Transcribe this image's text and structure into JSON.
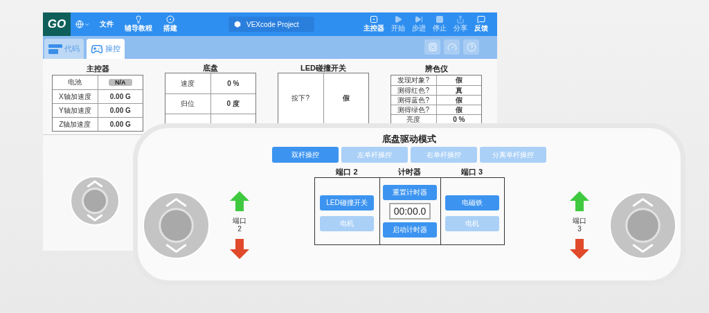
{
  "top_bar": {
    "logo": "GO",
    "project_title": "VEXcode Project",
    "left_items": [
      {
        "kind": "language"
      },
      {
        "kind": "menu",
        "label": "文件"
      },
      {
        "kind": "tutorial",
        "label": "辅导教程"
      },
      {
        "kind": "build",
        "label": "搭建"
      }
    ],
    "right_items": [
      {
        "kind": "brain",
        "label": "主控器",
        "disabled": false
      },
      {
        "kind": "start",
        "label": "开始",
        "disabled": true
      },
      {
        "kind": "step",
        "label": "步进",
        "disabled": true
      },
      {
        "kind": "stop",
        "label": "停止",
        "disabled": true
      },
      {
        "kind": "share",
        "label": "分享",
        "disabled": true
      },
      {
        "kind": "feedback",
        "label": "反馈",
        "disabled": false
      }
    ]
  },
  "tabs": [
    {
      "kind": "code",
      "label": "代码",
      "selected": false
    },
    {
      "kind": "drive",
      "label": "操控",
      "selected": true
    }
  ],
  "dashboard": [
    {
      "title": "主控器",
      "rows": [
        {
          "name": "电池",
          "value": "N/A",
          "kind": "battery"
        },
        {
          "name": "X轴加速度",
          "value": "0.00 G",
          "kind": "text"
        },
        {
          "name": "Y轴加速度",
          "value": "0.00 G",
          "kind": "text"
        },
        {
          "name": "Z轴加速度",
          "value": "0.00 G",
          "kind": "text"
        }
      ]
    },
    {
      "title": "底盘",
      "rows": [
        {
          "name": "速度",
          "value": "0 %",
          "kind": "text"
        },
        {
          "name": "归位",
          "value": "0 度",
          "kind": "text"
        }
      ]
    },
    {
      "title": "LED碰撞开关",
      "rows": [
        {
          "name": "按下?",
          "value": "假",
          "kind": "text"
        }
      ]
    },
    {
      "title": "辨色仪",
      "rows": [
        {
          "name": "发现对象?",
          "value": "假",
          "kind": "text"
        },
        {
          "name": "测得红色?",
          "value": "真",
          "kind": "text"
        },
        {
          "name": "测得蓝色?",
          "value": "假",
          "kind": "text"
        },
        {
          "name": "测得绿色?",
          "value": "假",
          "kind": "text"
        },
        {
          "name": "亮度",
          "value": "0 %",
          "kind": "text"
        }
      ]
    }
  ],
  "drive_panel": {
    "title": "底盘驱动模式",
    "modes": [
      {
        "label": "双杆操控",
        "selected": true
      },
      {
        "label": "左单杆操控",
        "selected": false
      },
      {
        "label": "右单杆操控",
        "selected": false
      },
      {
        "label": "分离单杆操控",
        "selected": false
      }
    ],
    "columns": [
      {
        "kind": "device",
        "title": "端口 2",
        "buttons": [
          {
            "label": "LED碰撞开关",
            "disabled": false
          },
          {
            "label": "电机",
            "disabled": true
          }
        ]
      },
      {
        "kind": "timer",
        "title": "计时器",
        "reset_label": "重置计时器",
        "display": "00:00.0",
        "start_label": "启动计时器"
      },
      {
        "kind": "device",
        "title": "端口 3",
        "buttons": [
          {
            "label": "电磁铁",
            "disabled": false
          },
          {
            "label": "电机",
            "disabled": true
          }
        ]
      }
    ],
    "left_port": {
      "label": "端口",
      "number": "2"
    },
    "right_port": {
      "label": "端口",
      "number": "3"
    }
  }
}
